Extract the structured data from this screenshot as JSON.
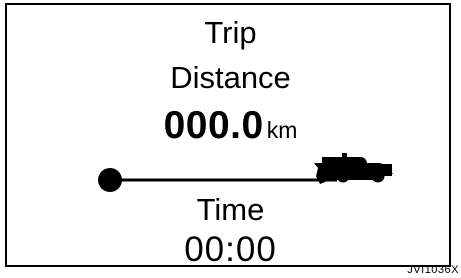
{
  "trip_label": "Trip",
  "distance_label": "Distance",
  "distance_value": "000.0",
  "distance_unit": "km",
  "time_label": "Time",
  "time_value": "00:00",
  "image_code": "JVI1036X",
  "colors": {
    "ink": "#000000",
    "background": "#ffffff"
  },
  "icons": {
    "start_marker": "filled-circle",
    "vehicle": "pickup-truck-icon"
  }
}
